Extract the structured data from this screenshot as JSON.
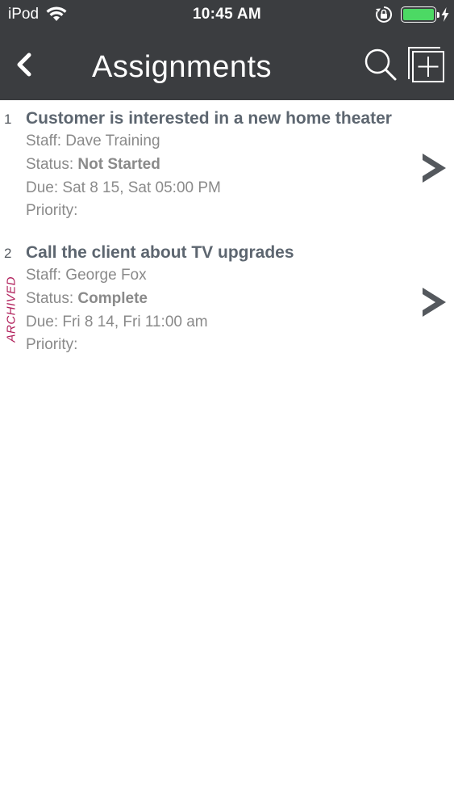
{
  "status_bar": {
    "carrier": "iPod",
    "time": "10:45 AM",
    "battery_color": "#4cd964"
  },
  "nav": {
    "title": "Assignments",
    "back_icon": "chevron-left-icon",
    "search_icon": "search-icon",
    "add_icon": "add-square-icon"
  },
  "assignments": [
    {
      "number": "1",
      "title": "Customer is interested in a new home theater",
      "staff": "Staff: Dave Training",
      "status_label": "Status: ",
      "status_value": "Not Started",
      "due": "Due: Sat 8 15, Sat 05:00 PM",
      "priority": "Priority:",
      "tag": ""
    },
    {
      "number": "2",
      "title": "Call the client about TV upgrades",
      "staff": "Staff: George Fox",
      "status_label": "Status: ",
      "status_value": "Complete",
      "due": "Due: Fri 8 14, Fri 11:00 am",
      "priority": "Priority:",
      "tag": "ARCHIVED"
    }
  ],
  "colors": {
    "bar_background": "#3b3d40",
    "title_text": "#5d6670",
    "detail_text": "#8a8a8a",
    "archived_tag": "#b01e5a"
  }
}
